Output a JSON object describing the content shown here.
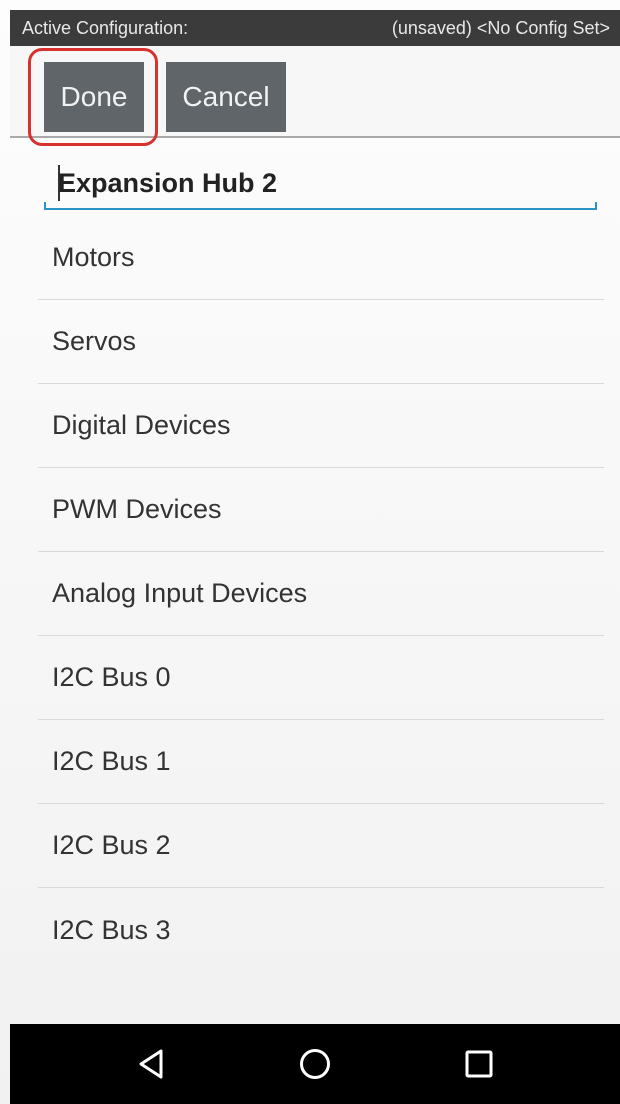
{
  "status": {
    "label": "Active Configuration:",
    "value": "(unsaved) <No Config Set>"
  },
  "toolbar": {
    "done_label": "Done",
    "cancel_label": "Cancel"
  },
  "name_field": {
    "value": "Expansion Hub 2"
  },
  "menu": {
    "items": [
      {
        "label": "Motors"
      },
      {
        "label": "Servos"
      },
      {
        "label": "Digital Devices"
      },
      {
        "label": "PWM Devices"
      },
      {
        "label": "Analog Input Devices"
      },
      {
        "label": "I2C Bus 0"
      },
      {
        "label": "I2C Bus 1"
      },
      {
        "label": "I2C Bus 2"
      },
      {
        "label": "I2C Bus 3"
      }
    ]
  },
  "nav": {
    "back_icon": "back-triangle-icon",
    "home_icon": "home-circle-icon",
    "recents_icon": "recents-square-icon"
  },
  "colors": {
    "status_bar": "#3b3b3b",
    "button": "#5f6568",
    "highlight": "#d6332f",
    "field_underline": "#2b93c4",
    "nav_bar": "#000000"
  }
}
